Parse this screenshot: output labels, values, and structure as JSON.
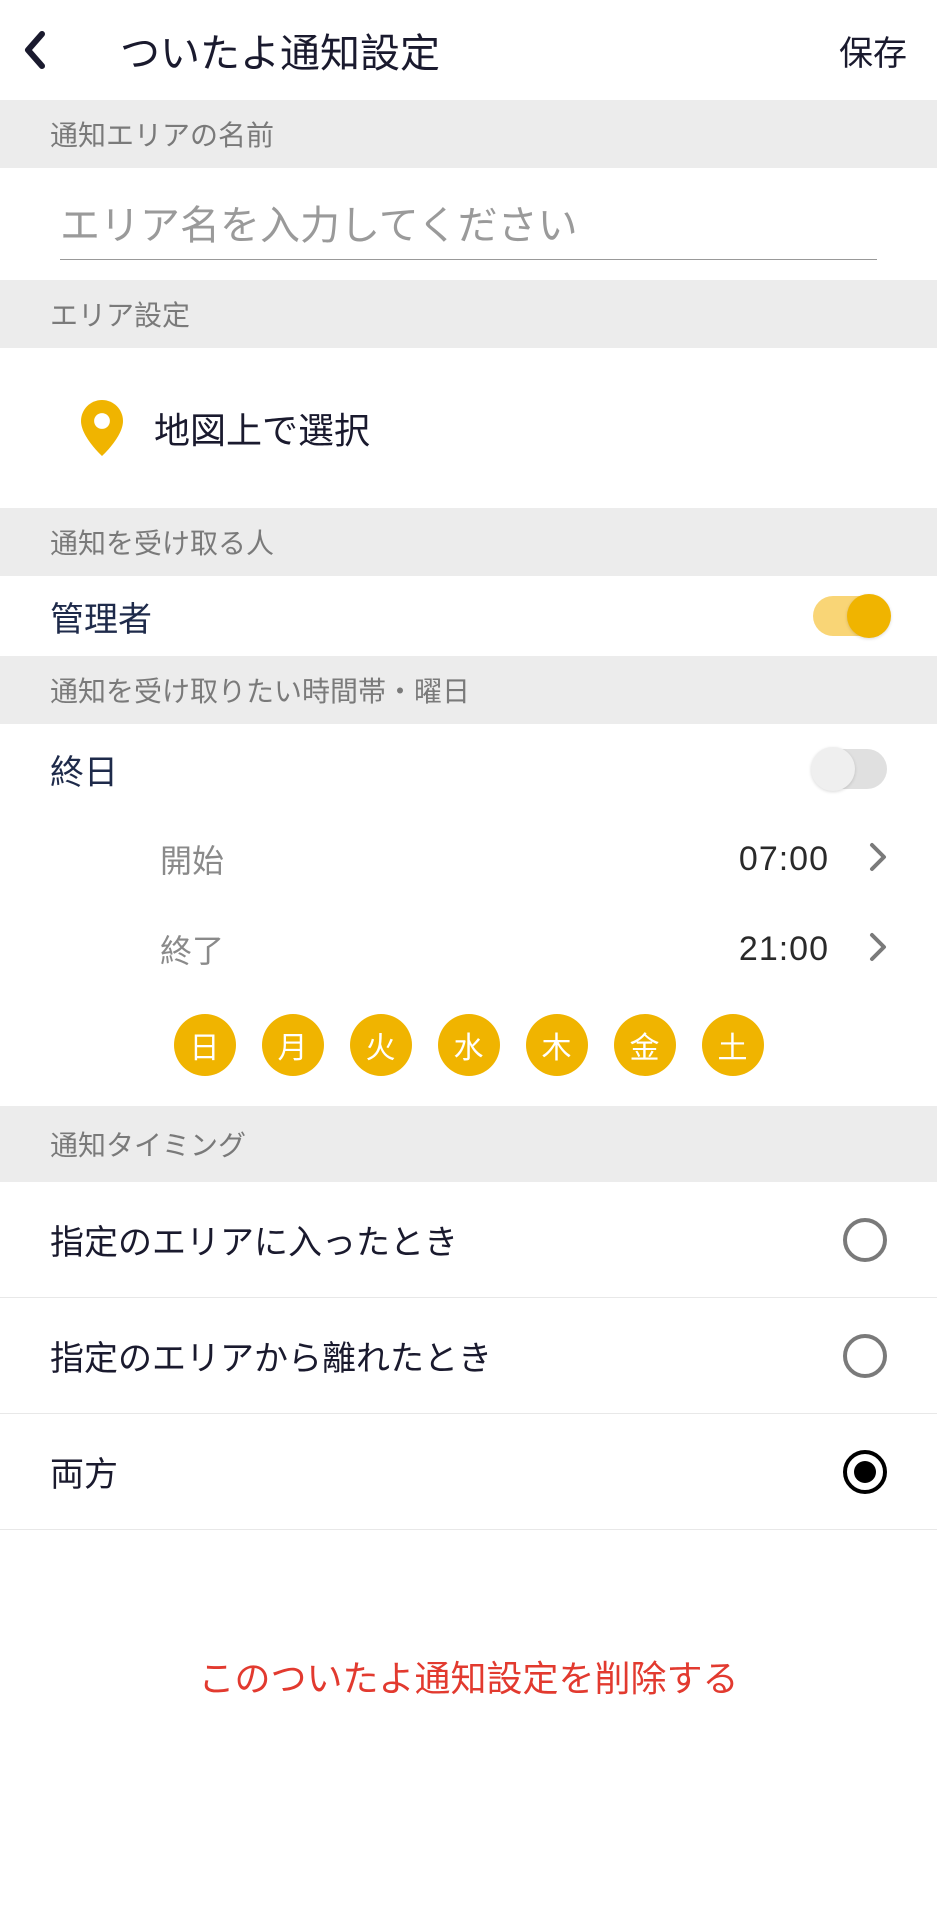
{
  "header": {
    "title": "ついたよ通知設定",
    "save_label": "保存"
  },
  "sections": {
    "area_name": "通知エリアの名前",
    "area_setting": "エリア設定",
    "recipients": "通知を受け取る人",
    "time_days": "通知を受け取りたい時間帯・曜日",
    "timing": "通知タイミング"
  },
  "input": {
    "placeholder": "エリア名を入力してください",
    "value": ""
  },
  "map": {
    "label": "地図上で選択"
  },
  "recipient": {
    "label": "管理者",
    "enabled": true
  },
  "all_day": {
    "label": "終日",
    "enabled": false
  },
  "start": {
    "label": "開始",
    "value": "07:00"
  },
  "end": {
    "label": "終了",
    "value": "21:00"
  },
  "days": [
    "日",
    "月",
    "火",
    "水",
    "木",
    "金",
    "土"
  ],
  "timing_options": {
    "enter": {
      "label": "指定のエリアに入ったとき",
      "selected": false
    },
    "leave": {
      "label": "指定のエリアから離れたとき",
      "selected": false
    },
    "both": {
      "label": "両方",
      "selected": true
    }
  },
  "delete_label": "このついたよ通知設定を削除する"
}
